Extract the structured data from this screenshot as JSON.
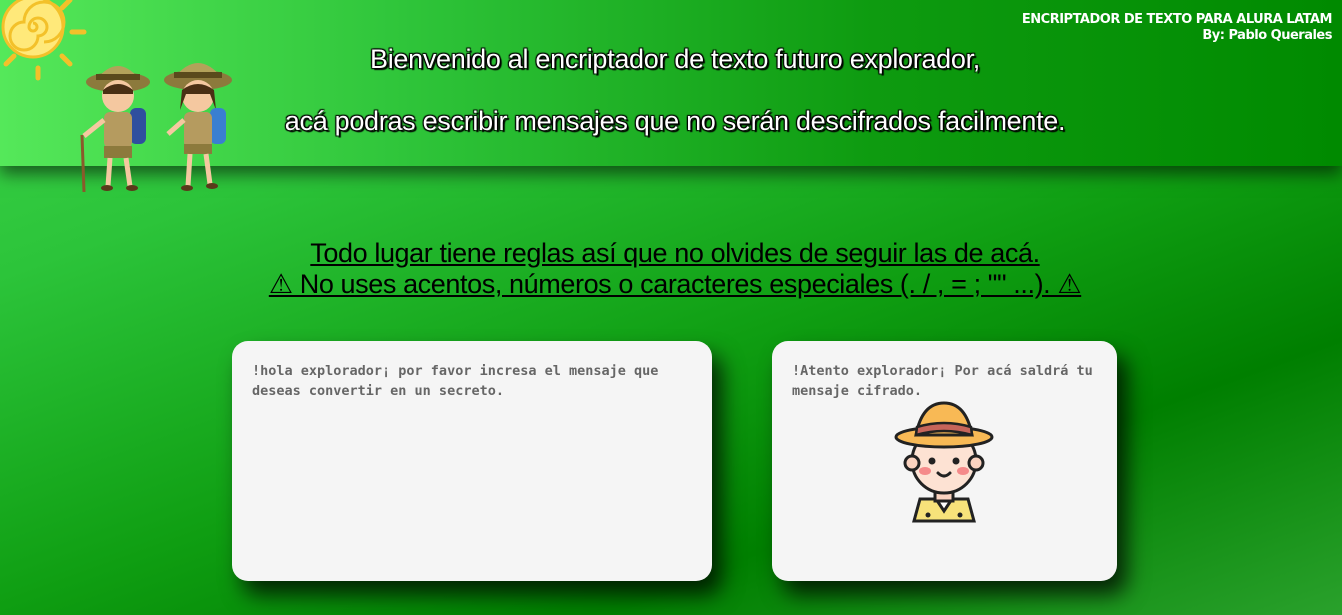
{
  "header": {
    "app_title": "ENCRIPTADOR DE TEXTO PARA ALURA LATAM",
    "author": "By: Pablo Querales",
    "welcome_line1": "Bienvenido al encriptador de texto futuro explorador,",
    "welcome_line2": "acá podras escribir mensajes que no serán descifrados facilmente.",
    "images": {
      "sun": "sun-icon",
      "kids": "explorer-kids-illustration"
    }
  },
  "rules": {
    "line1": "Todo lugar tiene reglas así que no olvides de seguir las de acá.",
    "line2": "⚠ No uses acentos, números o caracteres especiales (. / , = ; \"\" ...). ⚠"
  },
  "input": {
    "placeholder": "!hola explorador¡ por favor incresa el mensaje que deseas convertir en un secreto.",
    "value": ""
  },
  "output": {
    "placeholder": "!Atento explorador¡ Por acá saldrá tu mensaje cifrado.",
    "value": "",
    "image": "explorer-avatar-icon"
  },
  "colors": {
    "background": "#0f9e12",
    "card": "#f5f5f5",
    "placeholder_text": "#666666"
  }
}
